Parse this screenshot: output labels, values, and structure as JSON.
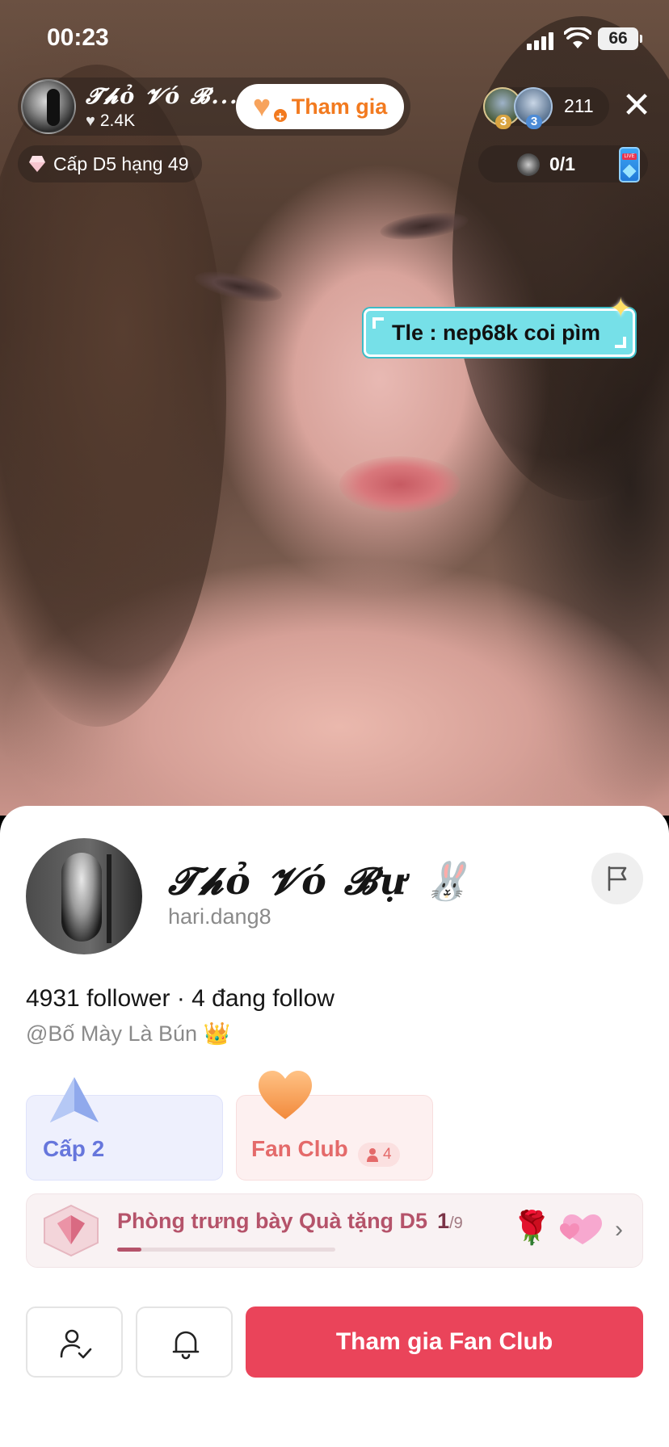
{
  "status_bar": {
    "time": "00:23",
    "battery": "66"
  },
  "live": {
    "host": {
      "name": "𝓣𝓱ỏ 𝓥ó 𝓑...",
      "likes": "2.4K"
    },
    "join_label": "Tham gia",
    "viewer_count": "211",
    "viewer_badges": [
      "3",
      "3"
    ],
    "level_label": "Cấp D5 hạng 49",
    "goal_progress": "0/1",
    "sticker_text": "Tle :  nep68k coi pìm"
  },
  "profile": {
    "name": "𝓣𝓱ỏ 𝓥ó 𝓑ự 🐰",
    "handle": "hari.dang8",
    "followers": "4931",
    "followers_label": "follower",
    "following": "4",
    "following_label": "đang follow",
    "bio": "@Bố Mày Là Bún 👑",
    "level_card_label": "Cấp 2",
    "fan_club_label": "Fan Club",
    "fan_club_count": "4",
    "gallery": {
      "title": "Phòng trưng bày Quà tặng D5",
      "count": "1",
      "total": "/9",
      "progress": 0.111
    },
    "join_fan_club_label": "Tham gia Fan Club"
  },
  "colors": {
    "accent_red": "#ea445a",
    "join_orange": "#f27a1f",
    "level_blue": "#6676dc",
    "fan_red": "#e46a6a",
    "sticker_cyan": "#76e0e8"
  },
  "icons": [
    "signal-icon",
    "wifi-icon",
    "battery-icon",
    "heart-icon",
    "join-heart-plus-icon",
    "close-icon",
    "diamond-icon",
    "phone-live-icon",
    "sparkle-icon",
    "flag-icon",
    "arrow-level-icon",
    "heart-fanclub-icon",
    "person-icon",
    "gem-gallery-icon",
    "rose-icon",
    "hearts-icon",
    "chevron-right-icon",
    "user-check-icon",
    "bell-icon"
  ]
}
